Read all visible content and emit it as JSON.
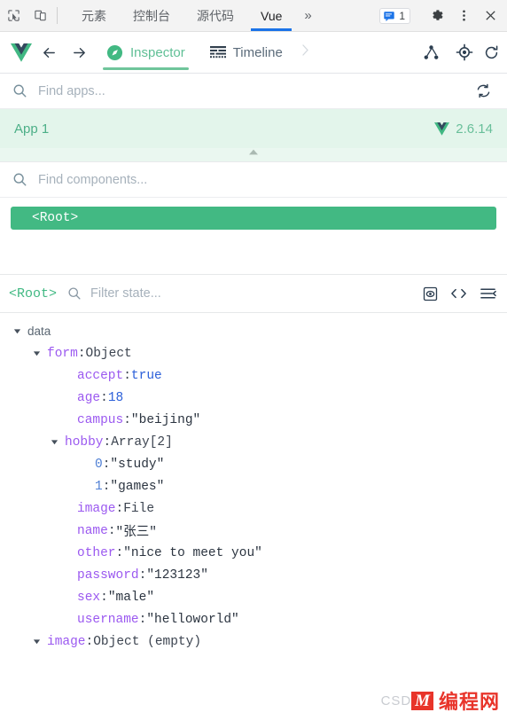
{
  "devtools": {
    "icons": {
      "inspect": "inspect-element-icon",
      "device": "device-toolbar-icon",
      "overflow": "more-tabs-icon",
      "settings": "gear-icon",
      "menu": "kebab-menu-icon",
      "close": "close-icon",
      "messages": "message-bubble-icon"
    },
    "tabs": [
      {
        "label": "元素",
        "active": false
      },
      {
        "label": "控制台",
        "active": false
      },
      {
        "label": "源代码",
        "active": false
      },
      {
        "label": "Vue",
        "active": true
      }
    ],
    "overflow_label": "»",
    "message_count": "1"
  },
  "vue_header": {
    "logo": "vue-logo-icon",
    "back": "back-arrow-icon",
    "forward": "forward-arrow-icon",
    "tabs": [
      {
        "label": "Inspector",
        "icon": "compass-icon",
        "active": true
      },
      {
        "label": "Timeline",
        "icon": "timeline-icon",
        "active": false
      }
    ],
    "more_chevron": "chevron-right-icon",
    "right_icons": [
      "component-tree-icon",
      "select-component-icon",
      "refresh-icon"
    ]
  },
  "app_search": {
    "placeholder": "Find apps...",
    "value": "",
    "refresh_icon": "refresh-apps-icon",
    "search_icon": "search-icon"
  },
  "app_row": {
    "name": "App 1",
    "version": "2.6.14",
    "vue_icon": "vue-logo-icon",
    "collapse_icon": "chevron-up-icon"
  },
  "component_search": {
    "placeholder": "Find components...",
    "value": "",
    "search_icon": "search-icon"
  },
  "component_tree": {
    "nodes": [
      {
        "label": "<Root>",
        "selected": true
      }
    ]
  },
  "state_header": {
    "root_label": "<Root>",
    "filter_placeholder": "Filter state...",
    "filter_value": "",
    "search_icon": "search-icon",
    "tools": [
      "inspect-dom-icon",
      "edit-as-code-icon",
      "collapse-all-icon"
    ]
  },
  "state_tree": {
    "rows": [
      {
        "indent": 0,
        "arrow": "down",
        "key": "data",
        "keyClass": "k-group",
        "sep": "",
        "value": "",
        "valueClass": ""
      },
      {
        "indent": 22,
        "arrow": "down",
        "key": "form",
        "keyClass": "k",
        "sep": ": ",
        "value": "Object",
        "valueClass": "v-type"
      },
      {
        "indent": 56,
        "arrow": "none",
        "key": "accept",
        "keyClass": "k",
        "sep": ": ",
        "value": "true",
        "valueClass": "v-bool"
      },
      {
        "indent": 56,
        "arrow": "none",
        "key": "age",
        "keyClass": "k",
        "sep": ": ",
        "value": "18",
        "valueClass": "v-num"
      },
      {
        "indent": 56,
        "arrow": "none",
        "key": "campus",
        "keyClass": "k",
        "sep": ": ",
        "value": "\"beijing\"",
        "valueClass": "v-str"
      },
      {
        "indent": 42,
        "arrow": "down",
        "key": "hobby",
        "keyClass": "k",
        "sep": ": ",
        "value": "Array[2]",
        "valueClass": "v-type"
      },
      {
        "indent": 76,
        "arrow": "none",
        "key": "0",
        "keyClass": "k-idx",
        "sep": ": ",
        "value": "\"study\"",
        "valueClass": "v-str"
      },
      {
        "indent": 76,
        "arrow": "none",
        "key": "1",
        "keyClass": "k-idx",
        "sep": ": ",
        "value": "\"games\"",
        "valueClass": "v-str"
      },
      {
        "indent": 56,
        "arrow": "none",
        "key": "image",
        "keyClass": "k",
        "sep": ": ",
        "value": "File",
        "valueClass": "v-type"
      },
      {
        "indent": 56,
        "arrow": "none",
        "key": "name",
        "keyClass": "k",
        "sep": ": ",
        "value": "\"张三\"",
        "valueClass": "v-str"
      },
      {
        "indent": 56,
        "arrow": "none",
        "key": "other",
        "keyClass": "k",
        "sep": ": ",
        "value": "\"nice to meet you\"",
        "valueClass": "v-str"
      },
      {
        "indent": 56,
        "arrow": "none",
        "key": "password",
        "keyClass": "k",
        "sep": ": ",
        "value": "\"123123\"",
        "valueClass": "v-str"
      },
      {
        "indent": 56,
        "arrow": "none",
        "key": "sex",
        "keyClass": "k",
        "sep": ": ",
        "value": "\"male\"",
        "valueClass": "v-str"
      },
      {
        "indent": 56,
        "arrow": "none",
        "key": "username",
        "keyClass": "k",
        "sep": ": ",
        "value": "\"helloworld\"",
        "valueClass": "v-str"
      },
      {
        "indent": 22,
        "arrow": "down",
        "key": "image",
        "keyClass": "k",
        "sep": ": ",
        "value": "Object (empty)",
        "valueClass": "v-type"
      }
    ]
  },
  "watermark": {
    "csdn": "CSDN",
    "mark": "M",
    "text": "编程网"
  },
  "colors": {
    "vue_green": "#42b983",
    "app_row_bg": "#e3f5eb",
    "tab_active_blue": "#1a73e8",
    "key_purple": "#9b59f0",
    "number_blue": "#2b5fd9",
    "watermark_red": "#e8342a"
  }
}
